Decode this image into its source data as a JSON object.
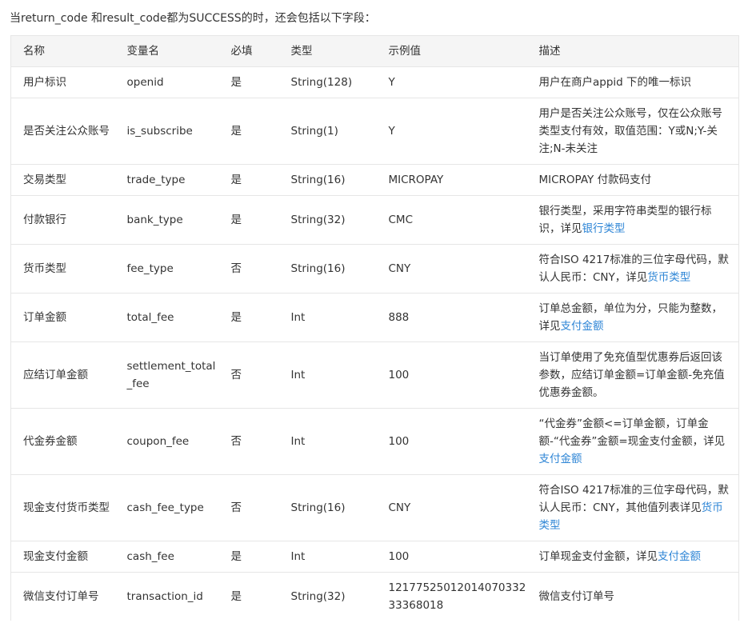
{
  "intro": "当return_code 和result_code都为SUCCESS的时，还会包括以下字段：",
  "headers": [
    "名称",
    "变量名",
    "必填",
    "类型",
    "示例值",
    "描述"
  ],
  "rows": [
    {
      "name": "用户标识",
      "var": "openid",
      "required": "是",
      "type": "String(128)",
      "example": "Y",
      "desc": "用户在商户appid 下的唯一标识",
      "link": ""
    },
    {
      "name": "是否关注公众账号",
      "var": "is_subscribe",
      "required": "是",
      "type": "String(1)",
      "example": "Y",
      "desc": "用户是否关注公众账号，仅在公众账号类型支付有效，取值范围：Y或N;Y-关注;N-未关注",
      "link": ""
    },
    {
      "name": "交易类型",
      "var": "trade_type",
      "required": "是",
      "type": "String(16)",
      "example": "MICROPAY",
      "desc": "MICROPAY 付款码支付",
      "link": ""
    },
    {
      "name": "付款银行",
      "var": "bank_type",
      "required": "是",
      "type": "String(32)",
      "example": "CMC",
      "desc": "银行类型，采用字符串类型的银行标识，详见",
      "link": "银行类型"
    },
    {
      "name": "货币类型",
      "var": "fee_type",
      "required": "否",
      "type": "String(16)",
      "example": "CNY",
      "desc": "符合ISO 4217标准的三位字母代码，默认人民币：CNY，详见",
      "link": "货币类型"
    },
    {
      "name": "订单金额",
      "var": "total_fee",
      "required": "是",
      "type": "Int",
      "example": "888",
      "desc": "订单总金额，单位为分，只能为整数，详见",
      "link": "支付金额"
    },
    {
      "name": "应结订单金额",
      "var": "settlement_total_fee",
      "required": "否",
      "type": "Int",
      "example": "100",
      "desc": "当订单使用了免充值型优惠券后返回该参数，应结订单金额=订单金额-免充值优惠券金额。",
      "link": ""
    },
    {
      "name": "代金券金额",
      "var": "coupon_fee",
      "required": "否",
      "type": "Int",
      "example": "100",
      "desc": "“代金券”金额<=订单金额，订单金额-“代金券”金额=现金支付金额，详见",
      "link": "支付金额"
    },
    {
      "name": "现金支付货币类型",
      "var": "cash_fee_type",
      "required": "否",
      "type": "String(16)",
      "example": "CNY",
      "desc": "符合ISO 4217标准的三位字母代码，默认人民币：CNY，其他值列表详见",
      "link": "货币类型"
    },
    {
      "name": "现金支付金额",
      "var": "cash_fee",
      "required": "是",
      "type": "Int",
      "example": "100",
      "desc": "订单现金支付金额，详见",
      "link": "支付金额"
    },
    {
      "name": "微信支付订单号",
      "var": "transaction_id",
      "required": "是",
      "type": "String(32)",
      "example": "1217752501201407033233368018",
      "desc": "微信支付订单号",
      "link": ""
    }
  ]
}
